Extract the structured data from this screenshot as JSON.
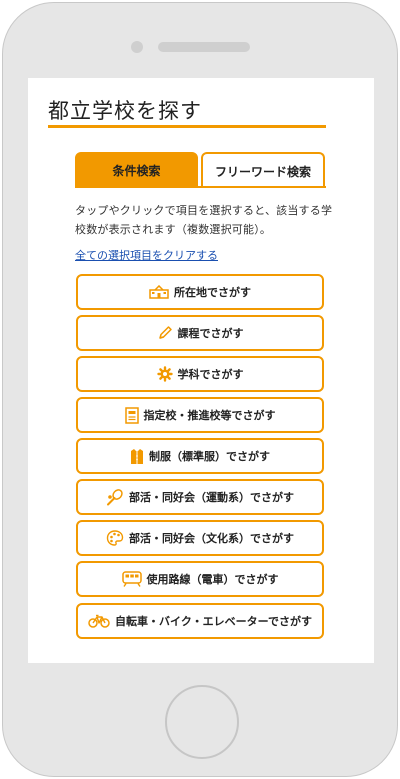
{
  "page": {
    "title": "都立学校を探す"
  },
  "tabs": [
    {
      "label": "条件検索",
      "active": true
    },
    {
      "label": "フリーワード検索",
      "active": false
    }
  ],
  "description": "タップやクリックで項目を選択すると、該当する学校数が表示されます（複数選択可能）。",
  "clear_link": "全ての選択項目をクリアする",
  "search_buttons": [
    {
      "label": "所在地でさがす",
      "icon": "school-building-icon"
    },
    {
      "label": "課程でさがす",
      "icon": "pencil-icon"
    },
    {
      "label": "学科でさがす",
      "icon": "gear-icon"
    },
    {
      "label": "指定校・推進校等でさがす",
      "icon": "document-icon"
    },
    {
      "label": "制服（標準服）でさがす",
      "icon": "uniform-icon"
    },
    {
      "label": "部活・同好会（運動系）でさがす",
      "icon": "racket-ball-icon"
    },
    {
      "label": "部活・同好会（文化系）でさがす",
      "icon": "paint-palette-icon"
    },
    {
      "label": "使用路線（電車）でさがす",
      "icon": "train-icon"
    },
    {
      "label": "自転車・バイク・エレベーターでさがす",
      "icon": "bicycle-icon"
    }
  ],
  "colors": {
    "accent": "#f29900",
    "link": "#1a4fb0"
  }
}
